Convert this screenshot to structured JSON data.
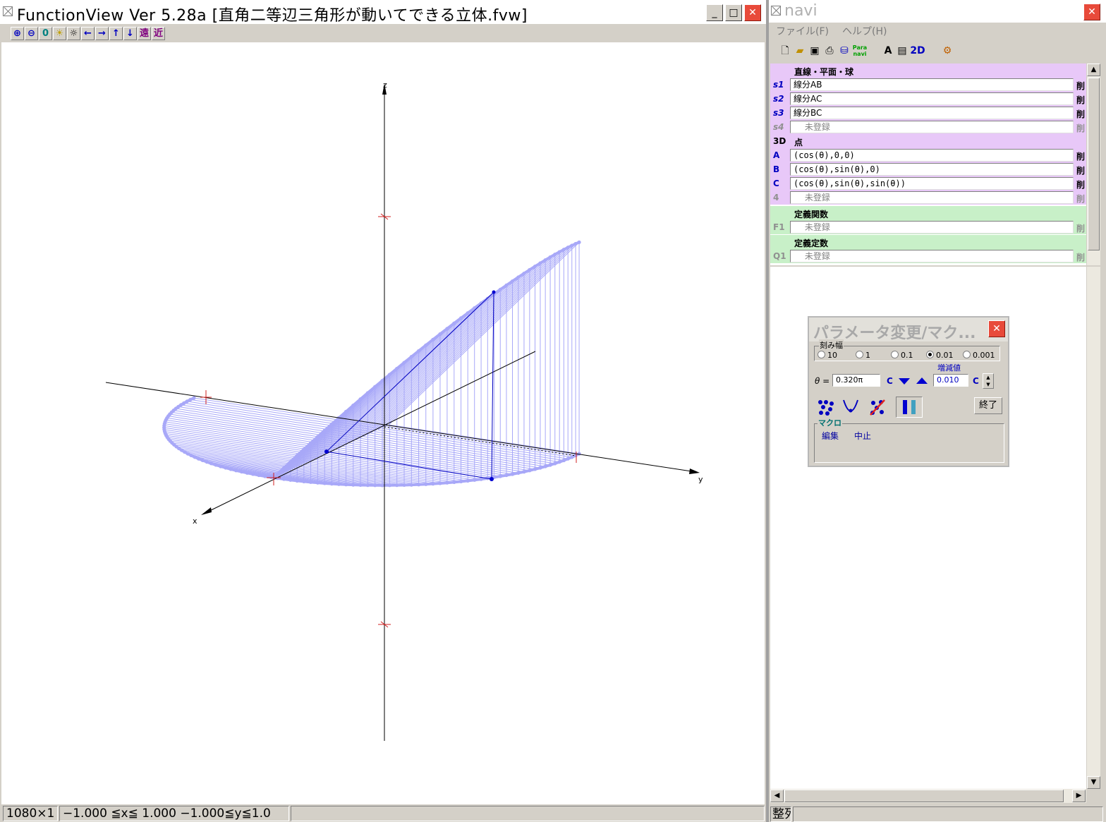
{
  "main_window": {
    "title": "FunctionView  Ver  5.28a  [直角二等辺三角形が動いてできる立体.fvw]",
    "toolbar": [
      "⊕",
      "⊖",
      "0",
      "☀",
      "☼",
      "←",
      "→",
      "↑",
      "↓",
      "遠",
      "近"
    ],
    "axes": {
      "x": "x",
      "y": "y",
      "z": "z"
    },
    "status": [
      "1080×1",
      "−1.000  ≦x≦  1.000   −1.000≦y≦1.0"
    ]
  },
  "navi_window": {
    "title": "navi",
    "menu": [
      "ファイル(F)",
      "ヘルプ(H)"
    ],
    "toolbar_labels": [
      "A",
      "2D"
    ],
    "para_icon_label": "Para navi",
    "sections": {
      "lines": {
        "title": "直線・平面・球",
        "rows": [
          {
            "tag": "s1",
            "value": "線分AB",
            "del": "削"
          },
          {
            "tag": "s2",
            "value": "線分AC",
            "del": "削"
          },
          {
            "tag": "s3",
            "value": "線分BC",
            "del": "削"
          },
          {
            "tag": "s4",
            "value": "　 未登録",
            "del": "削"
          }
        ]
      },
      "points": {
        "tag": "3D",
        "title": "点",
        "rows": [
          {
            "tag": "A",
            "value": "(cos(θ),0,0)",
            "del": "削"
          },
          {
            "tag": "B",
            "value": "(cos(θ),sin(θ),0)",
            "del": "削"
          },
          {
            "tag": "C",
            "value": "(cos(θ),sin(θ),sin(θ))",
            "del": "削"
          },
          {
            "tag": "4",
            "value": "　 未登録",
            "del": "削"
          }
        ]
      },
      "functions": {
        "title": "定義関数",
        "rows": [
          {
            "tag": "F1",
            "value": "　 未登録",
            "del": "削"
          }
        ]
      },
      "constants": {
        "title": "定義定数",
        "rows": [
          {
            "tag": "Q1",
            "value": "　 未登録",
            "del": "削"
          }
        ]
      }
    },
    "status": "整列"
  },
  "param_dialog": {
    "title": "パラメータ変更/マク...",
    "step_label": "刻み幅",
    "steps": [
      "10",
      "1",
      "0.1",
      "0.01",
      "0.001"
    ],
    "selected_step": "0.01",
    "theta_label": "θ =",
    "theta_value": "0.320π",
    "c_label": "C",
    "increment_label": "増減値",
    "increment_value": "0.010",
    "end_button": "終了",
    "macro_label": "マクロ",
    "macro_edit": "編集",
    "macro_stop": "中止"
  },
  "colors": {
    "surface": "#a8a8f8",
    "point": "#0000d0",
    "tick": "#d02020",
    "lines_header": "#e8c8f8",
    "func_header": "#c8f0c8"
  }
}
